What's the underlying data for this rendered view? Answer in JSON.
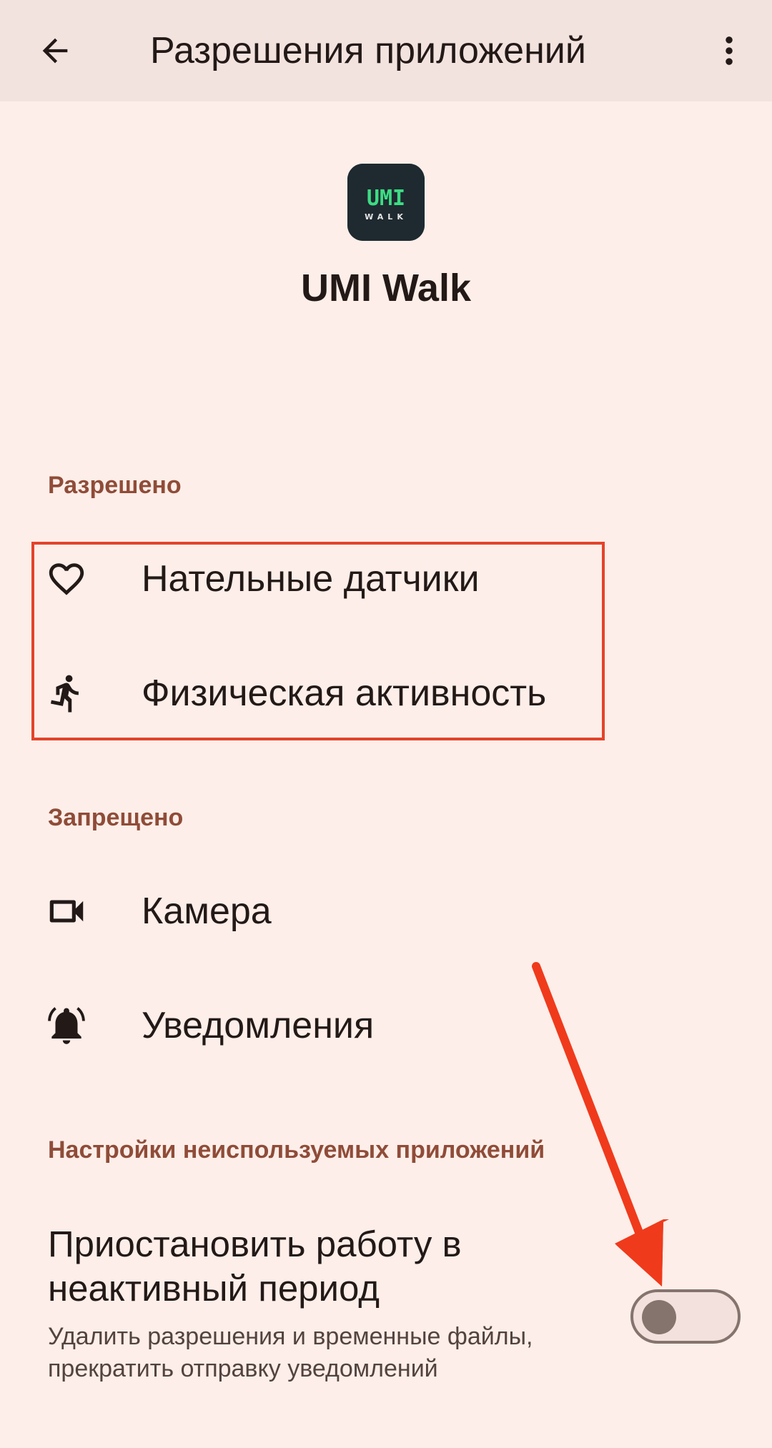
{
  "header": {
    "title": "Разрешения приложений"
  },
  "app": {
    "name": "UMI Walk",
    "icon_text_top": "UMI",
    "icon_text_bottom": "WALK"
  },
  "allowed": {
    "header": "Разрешено",
    "items": [
      {
        "label": "Нательные датчики",
        "icon": "heart-icon"
      },
      {
        "label": "Физическая активность",
        "icon": "running-person-icon"
      }
    ]
  },
  "denied": {
    "header": "Запрещено",
    "items": [
      {
        "label": "Камера",
        "icon": "camera-icon"
      },
      {
        "label": "Уведомления",
        "icon": "bell-icon"
      }
    ]
  },
  "unused": {
    "header": "Настройки неиспользуемых приложений",
    "title": "Приостановить работу в неактивный период",
    "subtitle": "Удалить разрешения и временные файлы, прекратить отправку уведомлений",
    "switch_on": false
  },
  "colors": {
    "background": "#fdeee9",
    "topbar": "#f2e3df",
    "section_header": "#8f4c38",
    "highlight": "#e5432a",
    "arrow": "#f03a1c"
  }
}
